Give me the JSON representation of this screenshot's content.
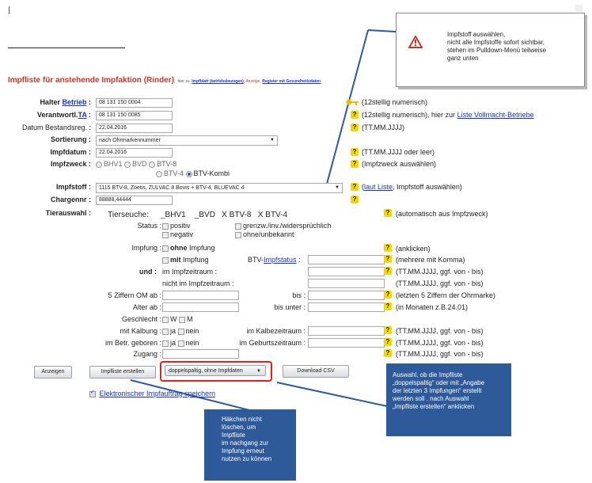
{
  "callouts": {
    "top": "Impfstoff auswählen,\nnicht alle Impfstoffe sofort sichtbar,\nstehen im Pulldown-Menü teilweise\nganz unten",
    "right": "Auswahl, ob die Impfliste\n„doppelspaltig“ oder mit „Angabe\nder letzten 3 Impfungen“ erstellt\nwerden soll . nach Auswahl\n„Impfliste erstellen“ anklicken",
    "bottom": "Häkchen nicht\nlöschen, um Impfliste\nim nachgang zur\nImpfung erneut\nnutzen zu können"
  },
  "header": {
    "title": "Impfliste für anstehende Impfaktion (Rinder)",
    "sep1": ",",
    "hier_zu": "hier zu",
    "impfblatt": "Impfblatt (betriebsbezogen)",
    "sep2": ", Anzeige",
    "register": "Register mit Gesundheitsdaten"
  },
  "form": {
    "halter_label": "Halter",
    "halter_link": "Betrieb",
    "colon": ":",
    "halter_value": "08 131 150 0004",
    "halter_help": "(12stellig numerisch)",
    "verantw_label": "Verantwortl.",
    "verantw_link": "TA",
    "verantw_value": "08 131 150 0085",
    "verantw_help_a": "(12stellig numerisch), hier zur",
    "verantw_help_link": "Liste Vollmacht-Betriebe",
    "datum_label": "Datum Bestandsreg. :",
    "datum_value": "22.04.2016",
    "datum_help": "(TT.MM.JJJJ)",
    "sort_label": "Sortierung :",
    "sort_value": "nach Ohrmarkennummer",
    "impfdatum_label": "Impfdatum :",
    "impfdatum_value": "22.04.2016",
    "impfdatum_help": "(TT.MM.JJJJ oder leer)",
    "zweck_label": "Impfzweck :",
    "zweck_opt1": "BHV1",
    "zweck_opt2": "BVD",
    "zweck_opt3": "BTV-8",
    "zweck_opt4": "BTV-4",
    "zweck_opt5": "BTV-Kombi",
    "zweck_help": "(Impfzweck auswählen)",
    "stoff_label": "Impfstoff :",
    "stoff_value": "1115 BTV-8, Zoetis, ZULVAC 8 Bovis + BTV-4, BLUEVAC 4",
    "stoff_help_link": "laut Liste",
    "stoff_help_a": "(",
    "stoff_help_b": ", Impfstoff auswählen)",
    "charge_label": "Chargennr :",
    "charge_value": "88888,44444",
    "tier_label": "Tierauswahl :",
    "seuche_label": "Tierseuche:",
    "seuche_vals": "_BHV1    _BVD   X BTV-8   X BTV-4",
    "seuche_help": "(automatisch aus Impfzweck)",
    "status_label": "Status :",
    "status_pos": "positiv",
    "status_grenz": "grenzw./inv./widersprüchlich",
    "status_neg": "negativ",
    "status_ohne": "ohne/unbekannt",
    "impfung_label": "Impfung :",
    "ohne": "ohne",
    "impfung_word": "Impfung",
    "impfung_help": "(anklicken)",
    "mit": "mit",
    "btv_label": "BTV-",
    "btv_link": "Impfstatus",
    "btv_help": "(mehrere mit Komma)",
    "und_label": "und :",
    "im_zeitraum": "im Impfzeitraum :",
    "zeitraum_help": "(TT.MM.JJJJ, ggf. von - bis)",
    "nicht_zeitraum": "nicht im Impfzeitraum :",
    "zeitraum_help2": "(TT.MM.JJJJ, ggf. von - bis)",
    "ziffern_label": "5 Ziffern OM ab :",
    "bis_label": "bis :",
    "ziffern_help": "(letzten 5 Ziffern der Ohrmarke)",
    "alter_label": "Alter ab :",
    "bis_unter": "bis unter :",
    "alter_help": "(in Monaten z.B.24.01)",
    "geschlecht_label": "Geschlecht :",
    "g_w": "W",
    "g_m": "M",
    "kalbung_label": "mit Kalbung :",
    "ja": "ja",
    "nein": "nein",
    "kalbe_label": "im Kalbezeitraum :",
    "kalbe_help": "(TT.MM.JJJJ, ggf. von - bis)",
    "betr_label": "im Betr. geboren :",
    "geburt_label": "im Geburtszeitraum :",
    "geburt_help": "(TT.MM.JJJJ, ggf. von - bis)",
    "zugang_label": "Zugang :",
    "zugang_help": "(TT.MM.JJJJ, ggf. von - bis)"
  },
  "actions": {
    "anzeigen": "Anzeigen",
    "impfliste": "Impfliste erstellen",
    "format_value": "doppelspaltig, ohne Impfdaten",
    "csv": "Download CSV",
    "speichern": "Elektronischer Impfauftrag speichern"
  },
  "colors": {
    "accent": "#1a35b8",
    "title": "#c0392b",
    "callout": "#2e5a9a",
    "help": "#f4d600",
    "highlight": "#e02020"
  }
}
